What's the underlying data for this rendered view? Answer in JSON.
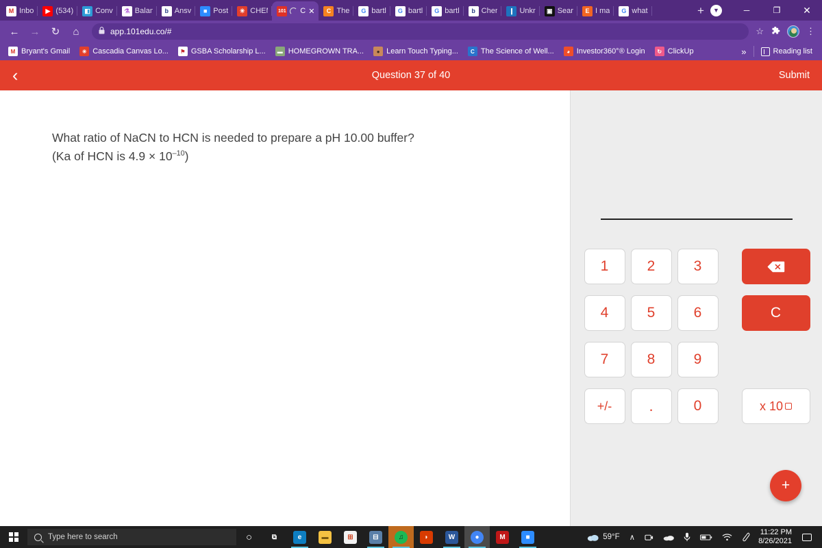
{
  "browser": {
    "tabs": [
      {
        "label": "Inbo",
        "icon": "gmail-icon",
        "color": "#fff",
        "glyph": "M",
        "gcolor": "#d93025",
        "active": false
      },
      {
        "label": "(534)",
        "icon": "youtube-icon",
        "color": "#ff0000",
        "glyph": "▶",
        "gcolor": "#ffffff",
        "active": false
      },
      {
        "label": "Conv",
        "icon": "canvas-icon",
        "color": "#2d9bd6",
        "glyph": "◧",
        "gcolor": "#ffffff",
        "active": false
      },
      {
        "label": "Balan",
        "icon": "flask-icon",
        "color": "#ffffff",
        "glyph": "⚗",
        "gcolor": "#b05ad8",
        "active": false
      },
      {
        "label": "Ansv",
        "icon": "bartleby-icon",
        "color": "#ffffff",
        "glyph": "b",
        "gcolor": "#2b3f87",
        "active": false
      },
      {
        "label": "Post",
        "icon": "zoom-icon",
        "color": "#2d8cff",
        "glyph": "■",
        "gcolor": "#ffffff",
        "active": false
      },
      {
        "label": "CHEM",
        "icon": "chem-icon",
        "color": "#e33f2c",
        "glyph": "✳",
        "gcolor": "#ffffff",
        "active": false
      },
      {
        "label": "C",
        "icon": "101edu-icon",
        "color": "#e03127",
        "glyph": "101",
        "gcolor": "#ffffff",
        "active": true
      },
      {
        "label": "The ",
        "icon": "coursehero-icon",
        "color": "#f58220",
        "glyph": "C",
        "gcolor": "#ffffff",
        "active": false
      },
      {
        "label": "bartl",
        "icon": "google-icon",
        "color": "#ffffff",
        "glyph": "G",
        "gcolor": "#4285f4",
        "active": false
      },
      {
        "label": "bartl",
        "icon": "google-icon",
        "color": "#ffffff",
        "glyph": "G",
        "gcolor": "#4285f4",
        "active": false
      },
      {
        "label": "bartl",
        "icon": "google-icon",
        "color": "#ffffff",
        "glyph": "G",
        "gcolor": "#4285f4",
        "active": false
      },
      {
        "label": "Cher",
        "icon": "bartleby-icon",
        "color": "#ffffff",
        "glyph": "b",
        "gcolor": "#2b3f87",
        "active": false
      },
      {
        "label": "Unkr",
        "icon": "numerade-icon",
        "color": "#1e73be",
        "glyph": "❙",
        "gcolor": "#ffffff",
        "active": false
      },
      {
        "label": "Sear",
        "icon": "search-app-icon",
        "color": "#111111",
        "glyph": "▣",
        "gcolor": "#ffffff",
        "active": false
      },
      {
        "label": "I ma",
        "icon": "e-icon",
        "color": "#f26522",
        "glyph": "E",
        "gcolor": "#ffffff",
        "active": false
      },
      {
        "label": "what",
        "icon": "google-icon",
        "color": "#ffffff",
        "glyph": "G",
        "gcolor": "#4285f4",
        "active": false
      }
    ],
    "new_tab_label": "+",
    "tab_close_label": "✕",
    "window_controls": {
      "minimize": "─",
      "maximize": "❐",
      "close": "✕",
      "update_badge": "▼"
    },
    "toolbar": {
      "back": "←",
      "forward": "→",
      "reload": "↻",
      "home": "⌂",
      "lock": "🔒",
      "url": "app.101edu.co/#",
      "bookmark_star": "☆",
      "extensions": "🧩",
      "menu": "⋮"
    },
    "bookmarks": [
      {
        "label": "Bryant's Gmail",
        "icon": "gmail-icon",
        "bg": "#ffffff",
        "glyph": "M",
        "fg": "#d93025"
      },
      {
        "label": "Cascadia Canvas Lo...",
        "icon": "canvas-icon",
        "bg": "#e33f2c",
        "glyph": "✳",
        "fg": "#ffffff"
      },
      {
        "label": "GSBA Scholarship L...",
        "icon": "gsba-icon",
        "bg": "#ffffff",
        "glyph": "⚑",
        "fg": "#c4262e"
      },
      {
        "label": "HOMEGROWN TRA...",
        "icon": "homegrown-icon",
        "bg": "#8aa87a",
        "glyph": "▬",
        "fg": "#ffffff"
      },
      {
        "label": "Learn Touch Typing...",
        "icon": "typing-icon",
        "bg": "#c9885a",
        "glyph": "●",
        "fg": "#3a2a20"
      },
      {
        "label": "The Science of Well...",
        "icon": "coursera-icon",
        "bg": "#2a73cc",
        "glyph": "C",
        "fg": "#ffffff"
      },
      {
        "label": "Investor360°® Login",
        "icon": "investor360-icon",
        "bg": "#f04e2a",
        "glyph": "◕",
        "fg": "#ffffff"
      },
      {
        "label": "ClickUp",
        "icon": "clickup-icon",
        "bg": "#f05a8a",
        "glyph": "↻",
        "fg": "#ffffff"
      }
    ],
    "bookmarks_overflow": "»",
    "reading_list_label": "Reading list"
  },
  "page": {
    "appbar": {
      "back_label": "‹",
      "title": "Question 37 of 40",
      "submit_label": "Submit"
    },
    "question": {
      "line1": "What ratio of NaCN to HCN is needed to prepare a pH 10.00 buffer?",
      "line2_pre": "(Ka of HCN is 4.9 × 10",
      "line2_exp": "–10",
      "line2_post": ")"
    },
    "answer_value": "",
    "keypad": {
      "keys": [
        "1",
        "2",
        "3",
        "4",
        "5",
        "6",
        "7",
        "8",
        "9",
        "+/-",
        ".",
        "0"
      ],
      "backspace_label": "✕",
      "clear_label": "C",
      "exponent_label": "x 10"
    },
    "fab_label": "+"
  },
  "taskbar": {
    "search_placeholder": "Type here to search",
    "cortana_label": "○",
    "apps": [
      {
        "name": "task-view",
        "glyph": "⧉",
        "bg": "transparent",
        "fg": "#ffffff",
        "open": false
      },
      {
        "name": "edge",
        "glyph": "e",
        "bg": "#0e7ec1",
        "fg": "#ffffff",
        "open": true
      },
      {
        "name": "file-explorer",
        "glyph": "▬",
        "bg": "#f5c242",
        "fg": "#7a5a10",
        "open": false
      },
      {
        "name": "microsoft-store",
        "glyph": "⊞",
        "bg": "#f2f2f2",
        "fg": "#d04a28",
        "open": false
      },
      {
        "name": "calculator",
        "glyph": "⊟",
        "bg": "#5a7fa8",
        "fg": "#ffffff",
        "open": true
      },
      {
        "name": "spotify",
        "glyph": "♫",
        "bg": "#1db954",
        "fg": "#0b2e18",
        "open": true
      },
      {
        "name": "office",
        "glyph": "◗",
        "bg": "#d83b01",
        "fg": "#ffffff",
        "open": false
      },
      {
        "name": "word",
        "glyph": "W",
        "bg": "#2b579a",
        "fg": "#ffffff",
        "open": true
      },
      {
        "name": "chrome",
        "glyph": "●",
        "bg": "#4285f4",
        "fg": "#ffffff",
        "open": true
      },
      {
        "name": "mcafee",
        "glyph": "M",
        "bg": "#c01818",
        "fg": "#ffffff",
        "open": false
      },
      {
        "name": "zoom",
        "glyph": "■",
        "bg": "#2d8cff",
        "fg": "#ffffff",
        "open": true
      }
    ],
    "tray": {
      "weather": "59°F",
      "chevron": "∧",
      "camera": "◎",
      "onedrive": "☁",
      "microphone": "♀",
      "battery": "▭",
      "wifi": "◠",
      "pen": "✎",
      "time": "11:22 PM",
      "date": "8/26/2021",
      "action_center": "□"
    }
  },
  "colors": {
    "brand_red": "#e33f2c",
    "key_red": "#e0402c",
    "chrome_purple": "#6a3fa0",
    "chrome_purple_dark": "#512a7e",
    "panel_gray": "#ededed"
  }
}
